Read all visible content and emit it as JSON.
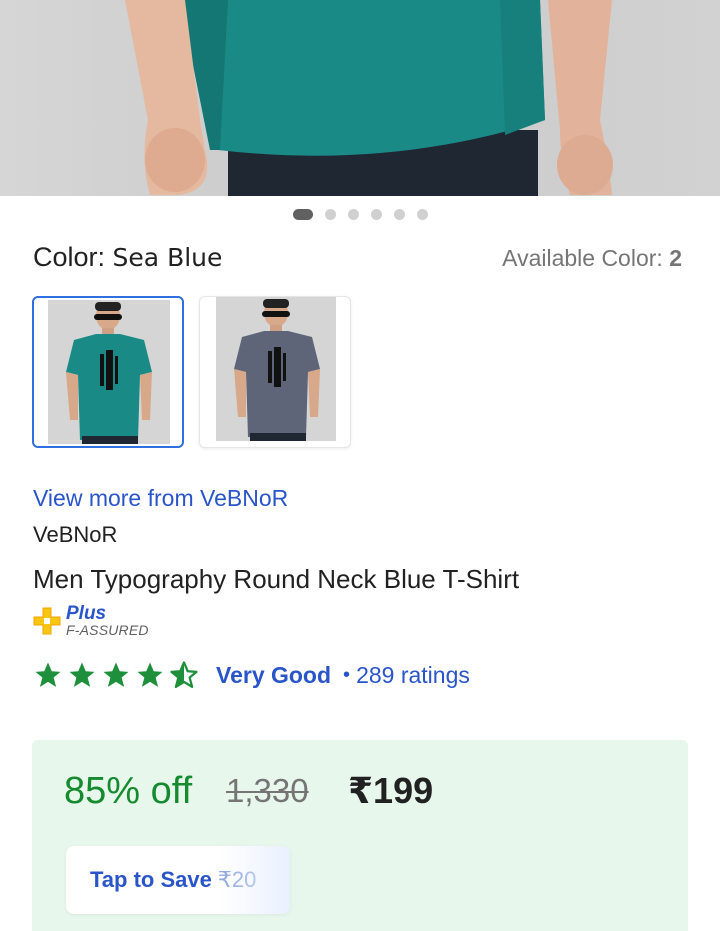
{
  "carousel": {
    "total": 6,
    "active": 0
  },
  "color": {
    "label": "Color:",
    "selected": "Sea Blue",
    "available_label": "Available Color:",
    "available_count": "2",
    "swatches": [
      {
        "name": "Sea Blue",
        "shirt_color": "#1a8a86",
        "selected": true
      },
      {
        "name": "Grey",
        "shirt_color": "#5f6578",
        "selected": false
      }
    ]
  },
  "seller": {
    "view_more": "View more from VeBNoR",
    "brand": "VeBNoR"
  },
  "product": {
    "title": "Men Typography Round Neck Blue T-Shirt"
  },
  "assured": {
    "plus": "Plus",
    "label": "F-ASSURED"
  },
  "rating": {
    "stars": 4.5,
    "word": "Very Good",
    "separator": "•",
    "count": "289 ratings"
  },
  "price": {
    "discount": "85% off",
    "mrp": "1,330",
    "final": "₹199",
    "save_label": "Tap to Save",
    "save_amount": "₹20"
  },
  "colors": {
    "accent": "#2a55c9",
    "discount_green": "#158a2e",
    "star_green": "#1e8f3a",
    "price_bg": "#e7f7ec",
    "tshirt_teal": "#1a8a86"
  }
}
